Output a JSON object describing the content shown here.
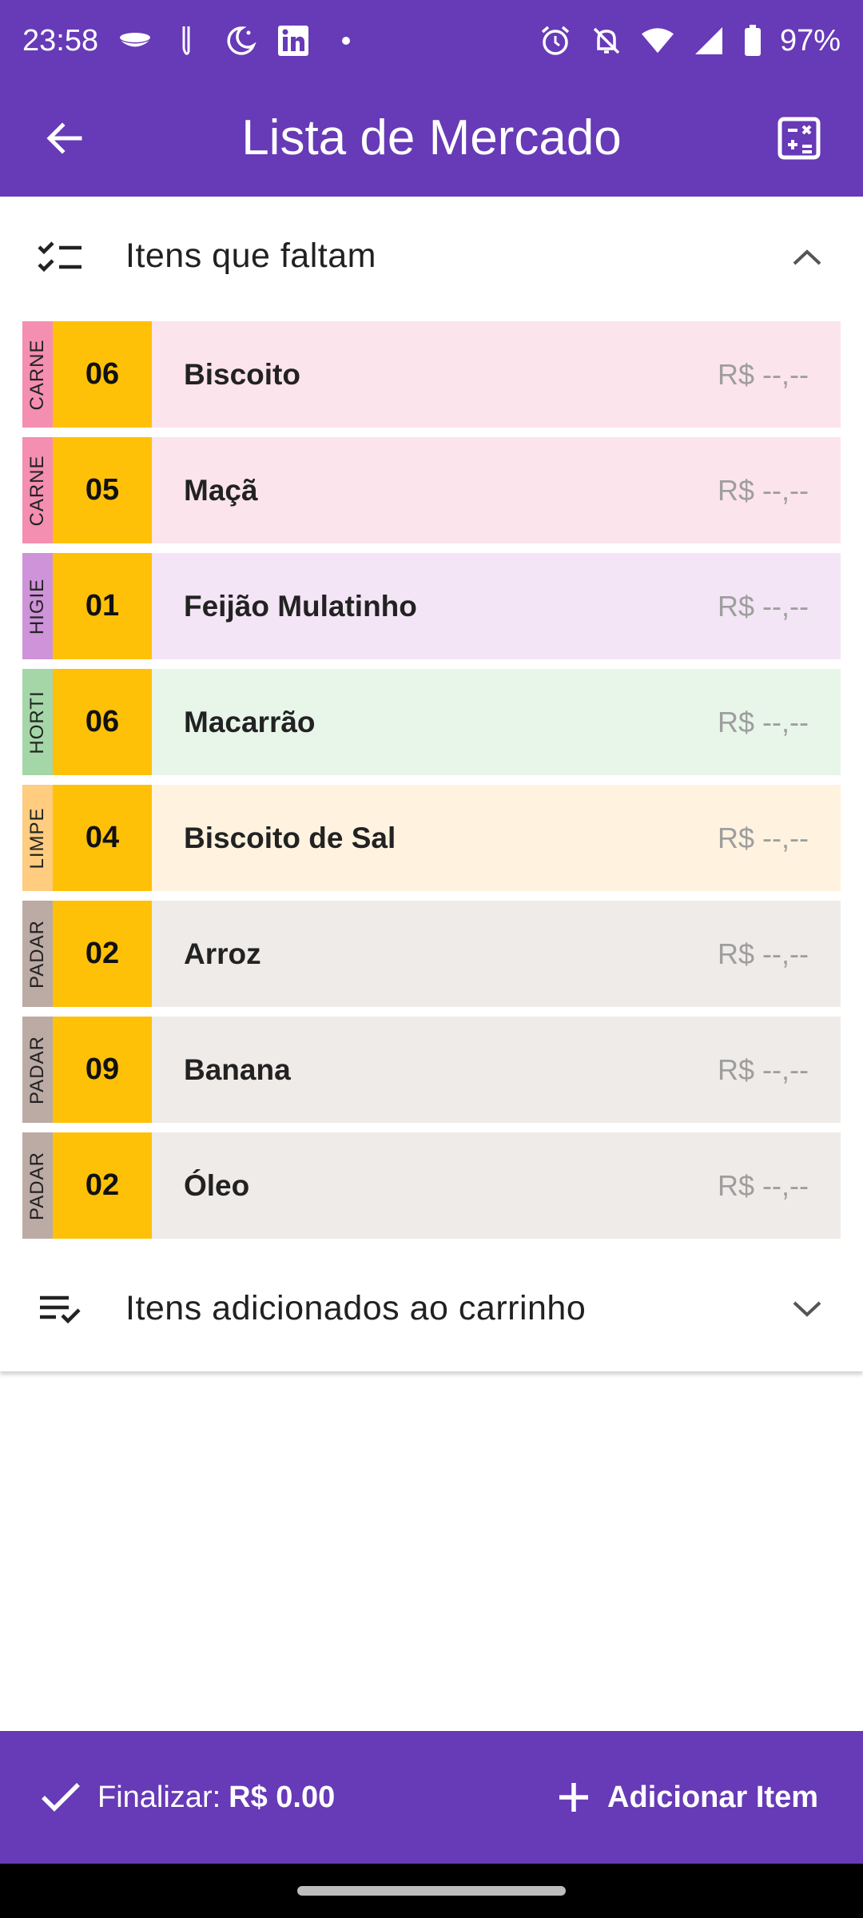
{
  "status_bar": {
    "time": "23:58",
    "battery": "97%",
    "left_icons": [
      "incognito-icon",
      "pen-icon",
      "moon-icon",
      "linkedin-icon",
      "dot-icon"
    ],
    "right_icons": [
      "alarm-icon",
      "bell-off-icon",
      "wifi-icon",
      "signal-icon",
      "battery-icon"
    ]
  },
  "app_bar": {
    "title": "Lista de Mercado",
    "back_icon": "arrow-back-icon",
    "action_icon": "calculator-icon",
    "color": "#673ab7"
  },
  "missing_section": {
    "title": "Itens que faltam",
    "expanded": true
  },
  "items": [
    {
      "category": "CARNE",
      "qty": "06",
      "name": "Biscoito",
      "price": "R$ --,--",
      "cat_color": "#f48fb1",
      "bg": "#fce4ec"
    },
    {
      "category": "CARNE",
      "qty": "05",
      "name": "Maçã",
      "price": "R$ --,--",
      "cat_color": "#f48fb1",
      "bg": "#fce4ec"
    },
    {
      "category": "HIGIE",
      "qty": "01",
      "name": "Feijão Mulatinho",
      "price": "R$ --,--",
      "cat_color": "#ce93d8",
      "bg": "#f3e5f5"
    },
    {
      "category": "HORTI",
      "qty": "06",
      "name": "Macarrão",
      "price": "R$ --,--",
      "cat_color": "#a5d6a7",
      "bg": "#e8f5e9"
    },
    {
      "category": "LIMPE",
      "qty": "04",
      "name": "Biscoito de Sal",
      "price": "R$ --,--",
      "cat_color": "#ffcc80",
      "bg": "#fff3e0"
    },
    {
      "category": "PADAR",
      "qty": "02",
      "name": "Arroz",
      "price": "R$ --,--",
      "cat_color": "#bcaaa4",
      "bg": "#efebe9"
    },
    {
      "category": "PADAR",
      "qty": "09",
      "name": "Banana",
      "price": "R$ --,--",
      "cat_color": "#bcaaa4",
      "bg": "#efebe9"
    },
    {
      "category": "PADAR",
      "qty": "02",
      "name": "Óleo",
      "price": "R$ --,--",
      "cat_color": "#bcaaa4",
      "bg": "#efebe9"
    }
  ],
  "cart_section": {
    "title": "Itens adicionados ao carrinho",
    "expanded": false
  },
  "bottom_bar": {
    "finalize_label": "Finalizar:",
    "finalize_value": "R$ 0.00",
    "add_label": "Adicionar Item"
  }
}
